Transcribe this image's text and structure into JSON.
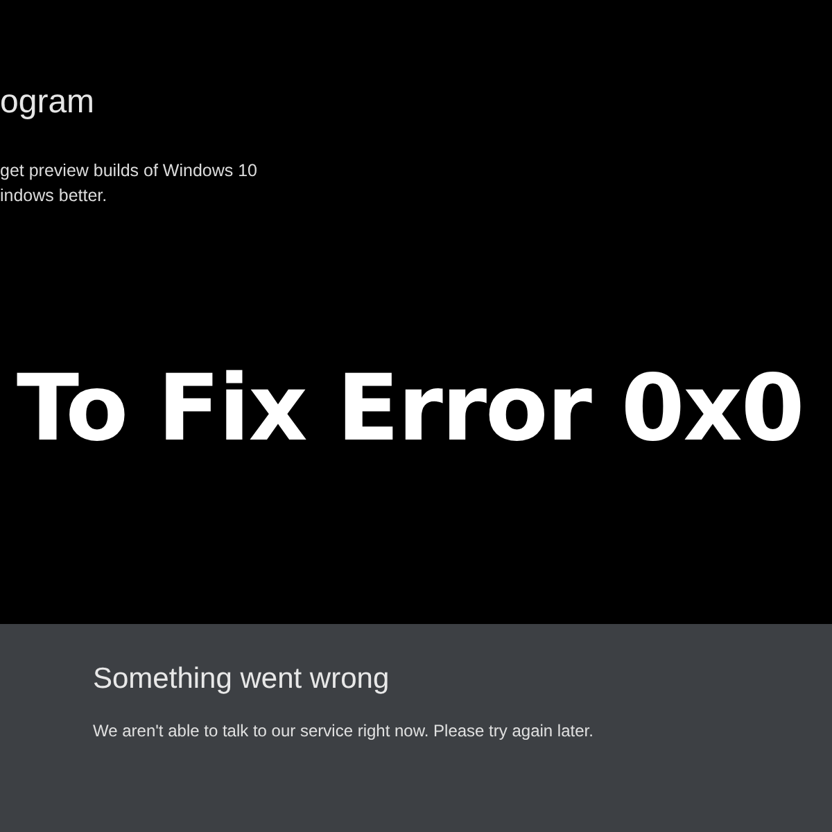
{
  "settings_page": {
    "title": "ogram",
    "description_lines": [
      "get preview builds of Windows 10",
      "indows better."
    ]
  },
  "overlay_headline": "To Fix Error 0x0",
  "error_panel": {
    "title": "Something went wrong",
    "message": "We aren't able to talk to our service right now. Please try again later."
  }
}
